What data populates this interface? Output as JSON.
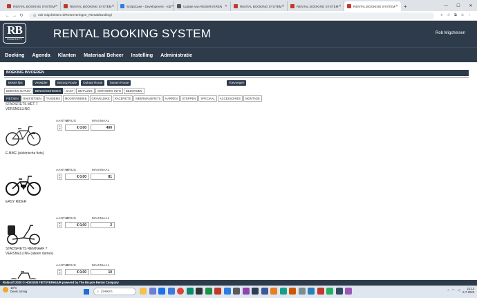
{
  "browser": {
    "tabs": [
      {
        "title": "RENTAL BOOKING SYSTEM",
        "active": false
      },
      {
        "title": "RENTAL BOOKING SYSTEM",
        "active": false
      },
      {
        "title": "ScriptCase - Development - rob",
        "active": false
      },
      {
        "title": "Update van RESERVEREN",
        "active": false
      },
      {
        "title": "RENTAL BOOKING SYSTEM",
        "active": false
      },
      {
        "title": "RENTAL BOOKING SYSTEM",
        "active": false
      },
      {
        "title": "RENTAL BOOKING SYSTEM",
        "active": true
      }
    ],
    "url": "rob-migchelsen.nl/Reserveringen_Rental/Booking/"
  },
  "app": {
    "logo_big": "RB",
    "logo_small": "ROBISOFT",
    "title": "RENTAL BOOKING SYSTEM",
    "user": "Rob Migchelsen",
    "nav": [
      "Boeking",
      "Agenda",
      "Klanten",
      "Materiaal Beheer",
      "Instelling",
      "Administratie"
    ]
  },
  "booking": {
    "section_title": "BOEKING INVOEREN",
    "actions": [
      "Bestel lijst",
      "Verwijder",
      "Bezorg Route",
      "Ophaal Route",
      "Tussen Route",
      "Toevoegen"
    ],
    "step_tabs": [
      "BOEKING DATUM",
      "BENODIGDHEDEN",
      "GAST",
      "BETALING",
      "VERVOERS INFO",
      "BEZORGEN"
    ],
    "active_step": 1,
    "category_tabs": [
      "FIETSEN",
      "BAKFIETSEN",
      "TANDEMS",
      "MOUNTAINBIKE",
      "GRAVELBIKE",
      "RACEFIETS",
      "MEERMANSFIETS",
      "KARREN",
      "STEPPEN",
      "SPECIAAL",
      "ACCESSOIRES",
      "MONTAGE"
    ],
    "active_category": 0,
    "col_qty": "AANTAL",
    "col_price": "PRIJS",
    "col_max": "MAXIMAAL",
    "products": [
      {
        "name": "STADSFIETS MET 7 VERSNELLING",
        "price": "€ 0,00",
        "max": "400"
      },
      {
        "name": "E-BIKE (elektrische fiets)",
        "price": "€ 0,00",
        "max": "81"
      },
      {
        "name": "EASY RIDER",
        "price": "€ 0,00",
        "max": "2"
      },
      {
        "name": "STADSFIETS REMNAAF 7 VERSNELLING (alleen dames)",
        "price": "€ 0,00",
        "max": "10"
      }
    ]
  },
  "footer": {
    "text": "Robisoft 2020 © HOEGEN FIETSVERHUUR powered by The Bicycle Rental Company"
  },
  "taskbar": {
    "weather_temp": "18°C",
    "weather_desc": "Deels zonnig",
    "search": "Zoeken",
    "time": "21:13",
    "date": "6-7-2025"
  },
  "colors": {
    "primary": "#2e3b4b",
    "chrome": "#dfe3e8"
  }
}
